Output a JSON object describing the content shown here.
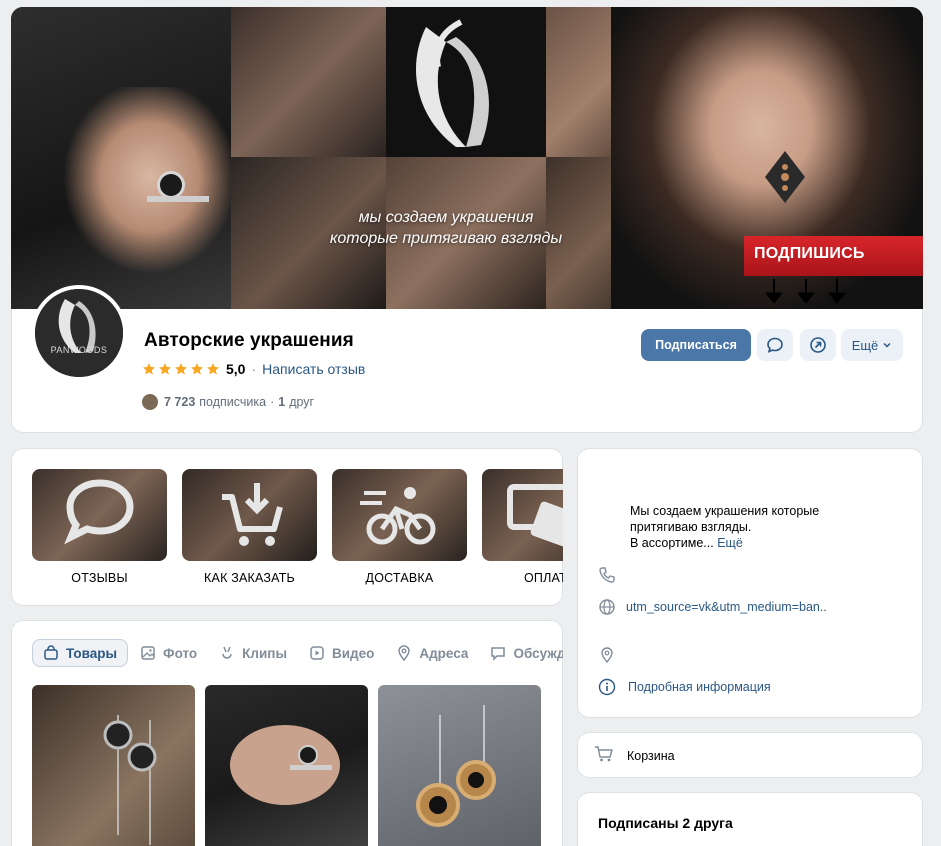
{
  "cover": {
    "promo_line1": "мы создаем украшения",
    "promo_line2": "которые притягиваю взгляды",
    "ribbon_text": "ПОДПИШИСЬ"
  },
  "group": {
    "avatar_label": "PANWOODS",
    "title": "Авторские украшения",
    "rating": "5,0",
    "rating_stars": 5,
    "write_review": "Написать отзыв",
    "followers_count": "7 723",
    "followers_label": "подписчика",
    "friends_count": "1",
    "friends_label": "друг",
    "separator": "·"
  },
  "actions": {
    "subscribe": "Подписаться",
    "more": "Ещё"
  },
  "menu": {
    "items": [
      {
        "label": "ОТЗЫВЫ",
        "icon": "chat-bubble-icon"
      },
      {
        "label": "КАК ЗАКАЗАТЬ",
        "icon": "cart-download-icon"
      },
      {
        "label": "ДОСТАВКА",
        "icon": "cyclist-icon"
      },
      {
        "label": "ОПЛАТА",
        "icon": "payment-icon"
      }
    ]
  },
  "tabs": [
    {
      "label": "Товары",
      "icon": "bag-icon",
      "active": true
    },
    {
      "label": "Фото",
      "icon": "photo-icon",
      "active": false
    },
    {
      "label": "Клипы",
      "icon": "clips-icon",
      "active": false
    },
    {
      "label": "Видео",
      "icon": "video-icon",
      "active": false
    },
    {
      "label": "Адреса",
      "icon": "location-icon",
      "active": false
    },
    {
      "label": "Обсуждения",
      "icon": "discussion-icon",
      "active": false
    }
  ],
  "info": {
    "desc_line1": "Мы создаем украшения которые",
    "desc_line2": "притягиваю взгляды.",
    "desc_line3": "В ассортиме...",
    "more": "Ещё",
    "link": "utm_source=vk&utm_medium=ban..",
    "details": "Подробная информация"
  },
  "cart": {
    "label": "Корзина"
  },
  "friends": {
    "title": "Подписаны 2 друга"
  },
  "colors": {
    "accent": "#4a76a8",
    "link": "#2a5885",
    "star": "#f5a623",
    "ribbon": "#c81d22",
    "background": "#edeef0"
  }
}
